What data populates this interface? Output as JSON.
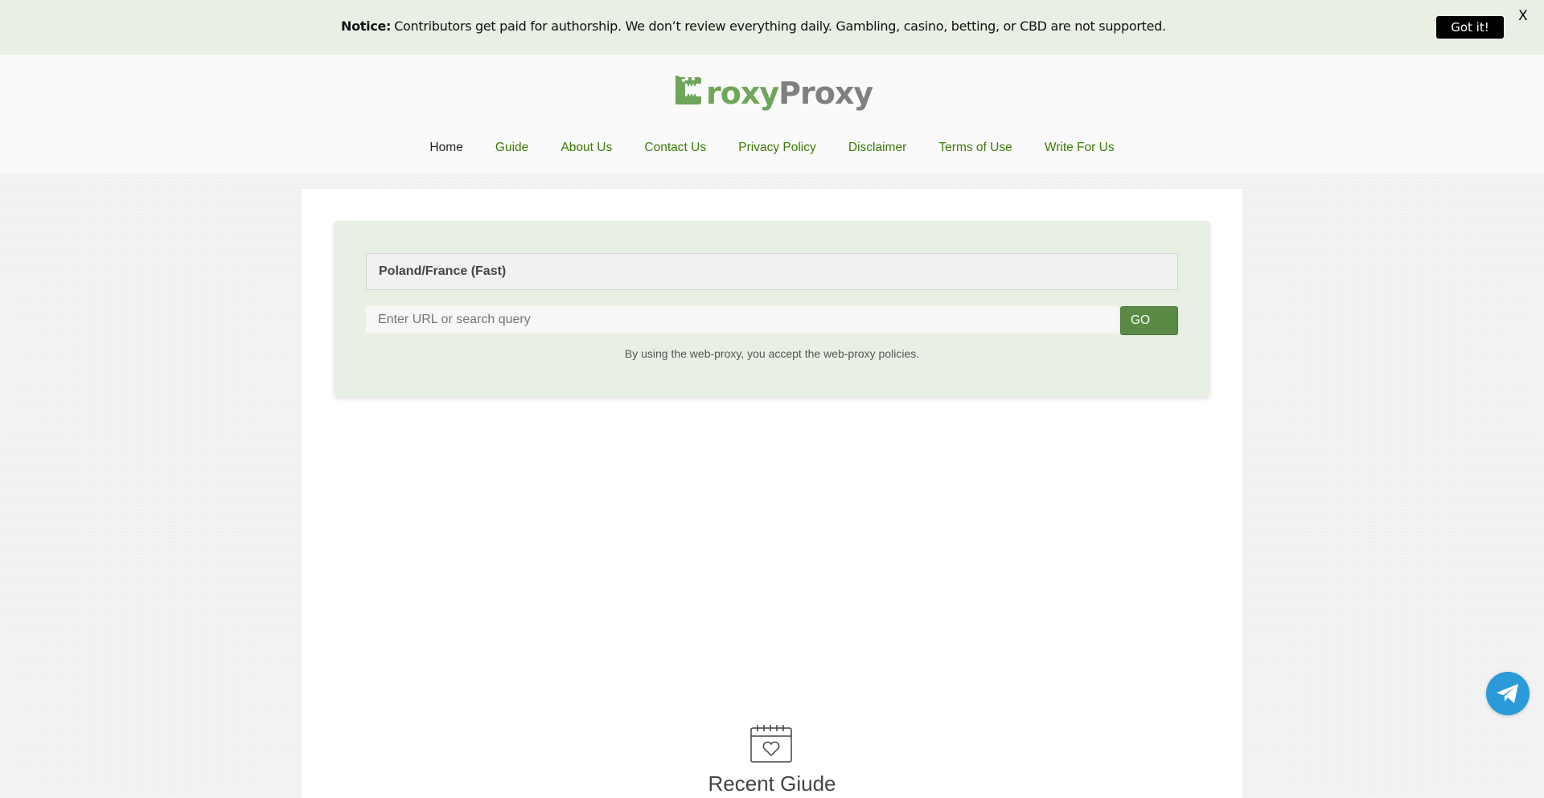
{
  "notice": {
    "label": "Notice:",
    "text": "Contributors get paid for authorship. We don’t review everything daily. Gambling, casino, betting, or CBD are not supported.",
    "button": "Got it!",
    "close": "X"
  },
  "logo": {
    "part1": "roxy",
    "part2": "Proxy",
    "icon": "crocodile-c-logo"
  },
  "nav": {
    "items": [
      "Home",
      "Guide",
      "About Us",
      "Contact Us",
      "Privacy Policy",
      "Disclaimer",
      "Terms of Use",
      "Write For Us"
    ],
    "active": "Home"
  },
  "proxy": {
    "server": "Poland/France (Fast)",
    "url_placeholder": "Enter URL or search query",
    "go_label": "GO",
    "policy_text": "By using the web-proxy, you accept the web-proxy policies."
  },
  "recent": {
    "title": "Recent Giude",
    "icon": "calendar-heart-icon"
  },
  "colors": {
    "accent_green": "#5a8a45",
    "nav_green": "#3b7a07",
    "notice_bg": "#e8efe3",
    "telegram_blue": "#2a9ad8"
  },
  "floating": {
    "icon": "telegram-icon"
  }
}
